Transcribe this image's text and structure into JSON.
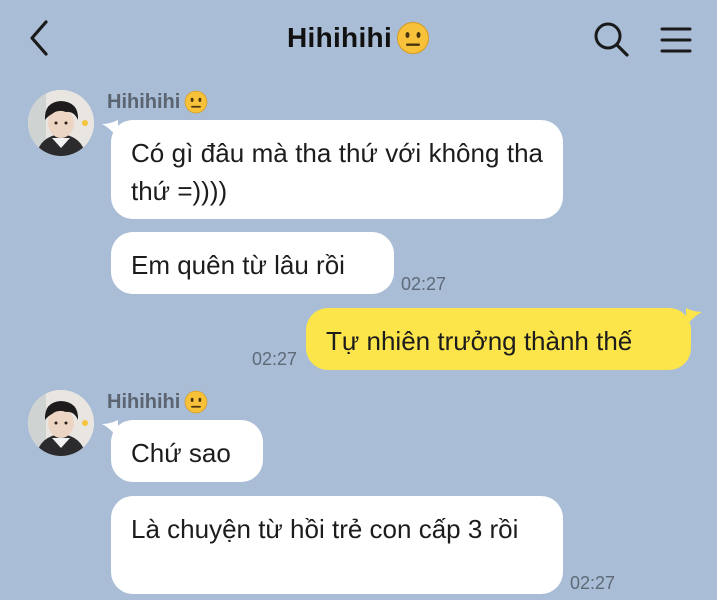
{
  "header": {
    "title": "Hihihihi",
    "title_emoji": "neutral-face-emoji",
    "back_icon": "chevron-left-icon",
    "search_icon": "search-icon",
    "menu_icon": "hamburger-menu-icon"
  },
  "colors": {
    "background": "#a9bdd6",
    "incoming_bubble": "#ffffff",
    "outgoing_bubble": "#fbe54a",
    "timestamp": "#5e6a78"
  },
  "messages": {
    "group1": {
      "sender": "Hihihihi",
      "items": [
        {
          "text": "Có gì đâu mà tha thứ với không tha thứ =))))"
        },
        {
          "text": "Em quên từ lâu rồi",
          "time": "02:27"
        }
      ]
    },
    "outgoing": {
      "text": "Tự nhiên trưởng thành thế",
      "time": "02:27"
    },
    "group2": {
      "sender": "Hihihihi",
      "items": [
        {
          "text": "Chứ sao"
        },
        {
          "text": "Là chuyện từ hồi trẻ con cấp 3 rồi",
          "time": "02:27"
        }
      ]
    }
  }
}
